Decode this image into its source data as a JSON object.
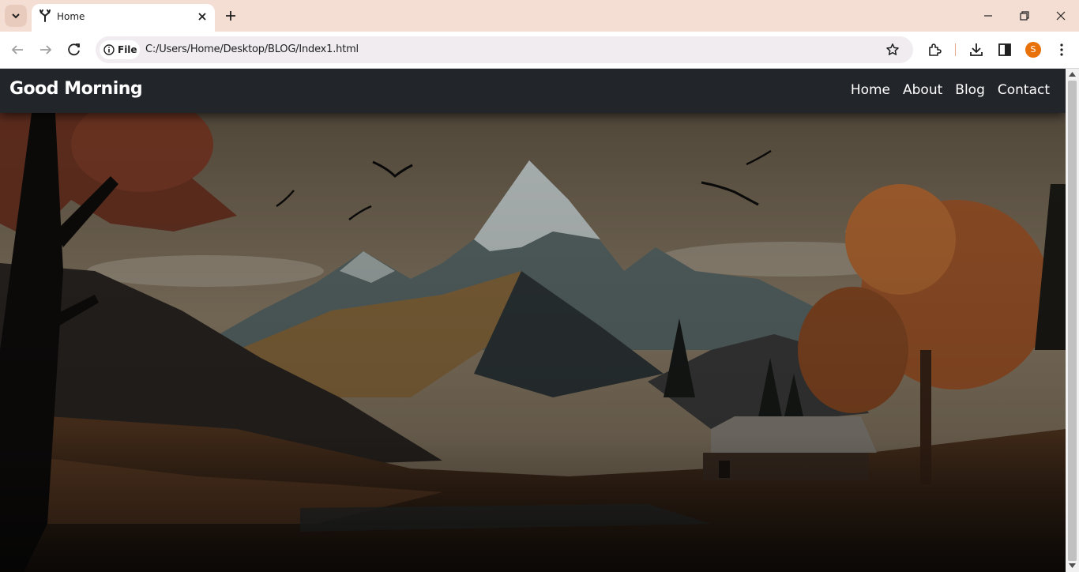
{
  "browser": {
    "tab": {
      "title": "Home",
      "favicon": "deer-antler-icon"
    },
    "omnibox": {
      "site_chip": "File",
      "url": "C:/Users/Home/Desktop/BLOG/Index1.html"
    },
    "profile_initial": "S",
    "colors": {
      "tabstrip": "#f4ddd3",
      "avatar": "#e8710a"
    }
  },
  "site": {
    "brand": "Good Morning",
    "nav": [
      {
        "label": "Home"
      },
      {
        "label": "About"
      },
      {
        "label": "Blog"
      },
      {
        "label": "Contact"
      }
    ],
    "hero": {
      "image": "autumn-mountain-landscape",
      "colors": {
        "nav_bg": "#22252a",
        "sky": "#8a7a62",
        "foliage": "#a0562a"
      }
    }
  }
}
